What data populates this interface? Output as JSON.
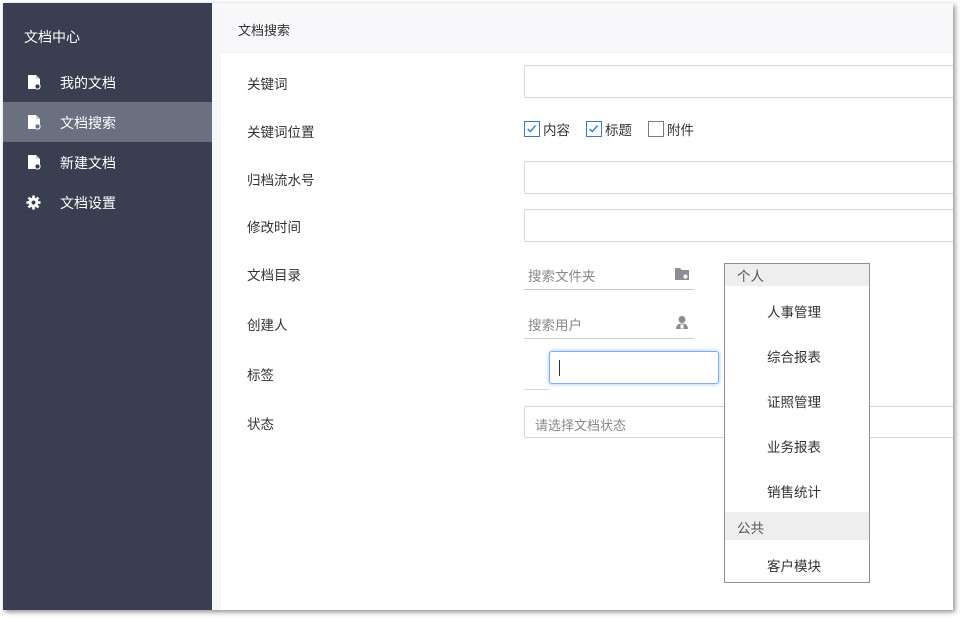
{
  "sidebar": {
    "title": "文档中心",
    "items": [
      {
        "label": "我的文档",
        "icon": "document-icon",
        "active": false
      },
      {
        "label": "文档搜索",
        "icon": "document-search-icon",
        "active": true
      },
      {
        "label": "新建文档",
        "icon": "document-add-icon",
        "active": false
      },
      {
        "label": "文档设置",
        "icon": "gear-icon",
        "active": false
      }
    ]
  },
  "header": {
    "title": "文档搜索"
  },
  "form": {
    "keyword": {
      "label": "关键词",
      "value": ""
    },
    "keyword_position": {
      "label": "关键词位置",
      "options": [
        {
          "label": "内容",
          "checked": true
        },
        {
          "label": "标题",
          "checked": true
        },
        {
          "label": "附件",
          "checked": false
        }
      ]
    },
    "archive_no": {
      "label": "归档流水号",
      "value": ""
    },
    "modified_time": {
      "label": "修改时间",
      "value": ""
    },
    "directory": {
      "label": "文档目录",
      "placeholder": "搜索文件夹",
      "icon": "folder-icon"
    },
    "creator": {
      "label": "创建人",
      "placeholder": "搜索用户",
      "icon": "user-icon"
    },
    "tag": {
      "label": "标签",
      "value": ""
    },
    "status": {
      "label": "状态",
      "placeholder": "请选择文档状态"
    }
  },
  "dropdown": {
    "groups": [
      {
        "name": "个人",
        "items": [
          "人事管理",
          "综合报表",
          "证照管理",
          "业务报表",
          "销售统计"
        ]
      },
      {
        "name": "公共",
        "items": [
          "客户模块"
        ]
      }
    ]
  },
  "colors": {
    "sidebar_bg": "#393f50",
    "sidebar_active": "#6a707f",
    "accent": "#3879c9"
  }
}
